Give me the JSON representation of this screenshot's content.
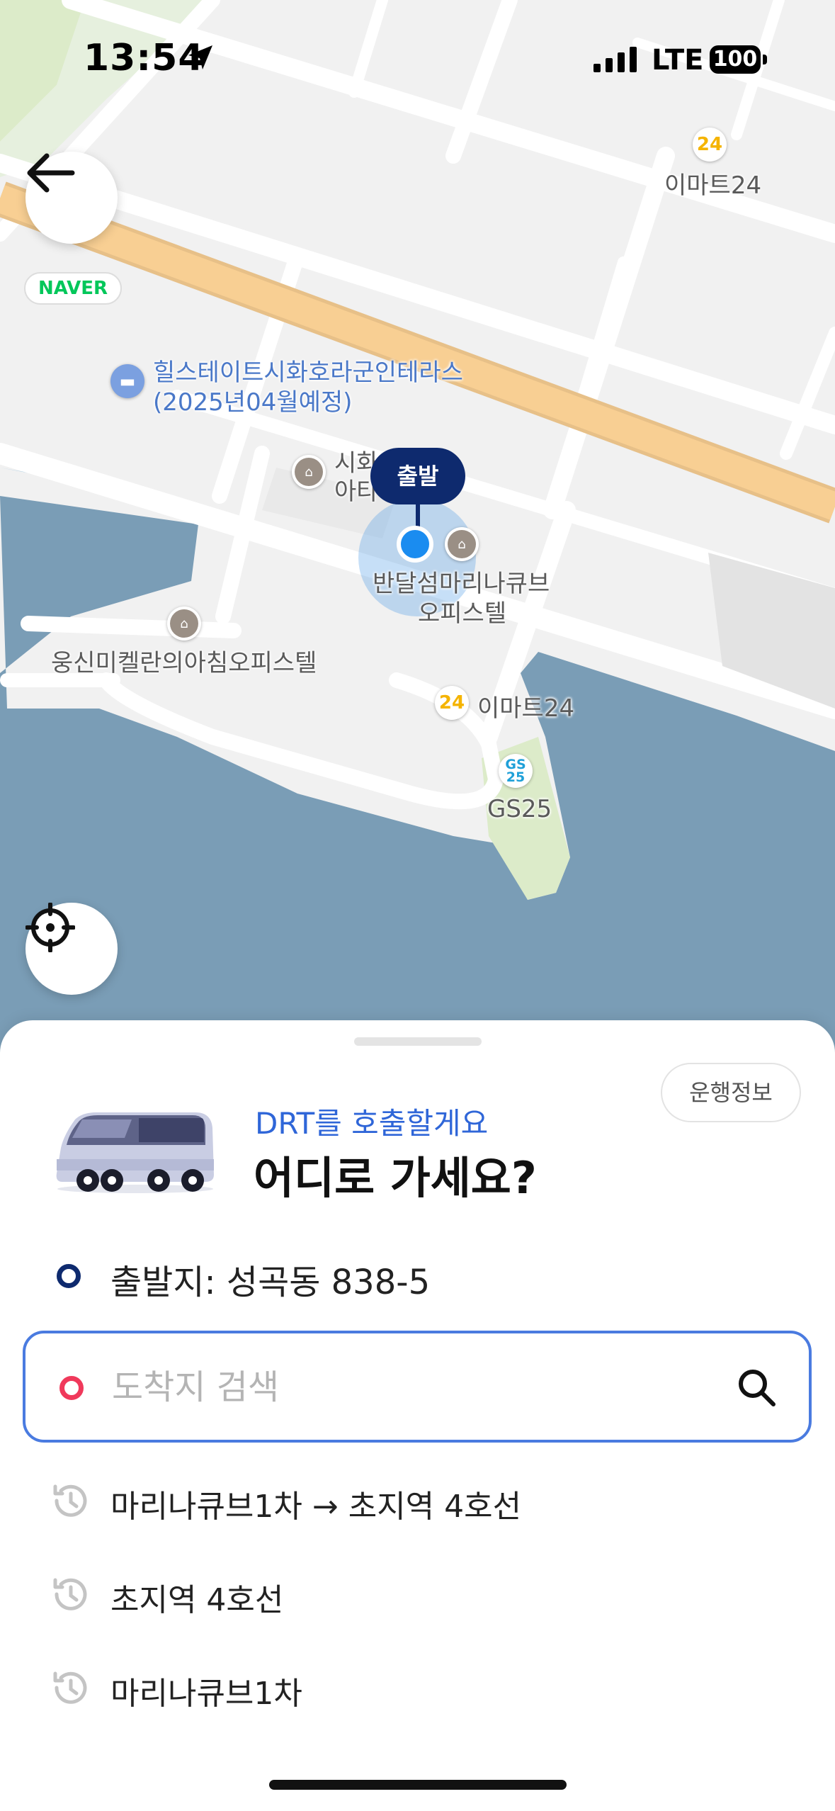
{
  "status_bar": {
    "time": "13:54",
    "network": "LTE",
    "battery": "100"
  },
  "map": {
    "badge": "NAVER",
    "labels": {
      "emart_top": "이마트24",
      "hillstate_line1": "힐스테이트시화호라군인테라스",
      "hillstate_line2": "(2025년04월예정)",
      "sihwa_line1": "시화",
      "sihwa_line2": "아타",
      "bandal_line1": "반달섬마리나큐브",
      "bandal_line2": "오피스텔",
      "woongshin": "웅신미켈란의아침오피스텔",
      "emart_mid": "이마트24",
      "gs25": "GS25"
    },
    "pin_label": "출발",
    "colors": {
      "water": "#7a9db6",
      "highway": "#f8cf93",
      "park": "#dcebc9"
    }
  },
  "sheet": {
    "service_info_button": "운행정보",
    "subtitle": "DRT를 호출할게요",
    "title": "어디로 가세요?",
    "origin": "출발지: 성곡동 838-5",
    "search": {
      "placeholder": "도착지 검색",
      "value": ""
    },
    "history": [
      {
        "label": "마리나큐브1차 → 초지역 4호선"
      },
      {
        "label": "초지역 4호선"
      },
      {
        "label": "마리나큐브1차"
      }
    ],
    "colors": {
      "accent_blue": "#2f66d8",
      "navy": "#0e2a6e",
      "destination_red": "#f0395b"
    }
  }
}
